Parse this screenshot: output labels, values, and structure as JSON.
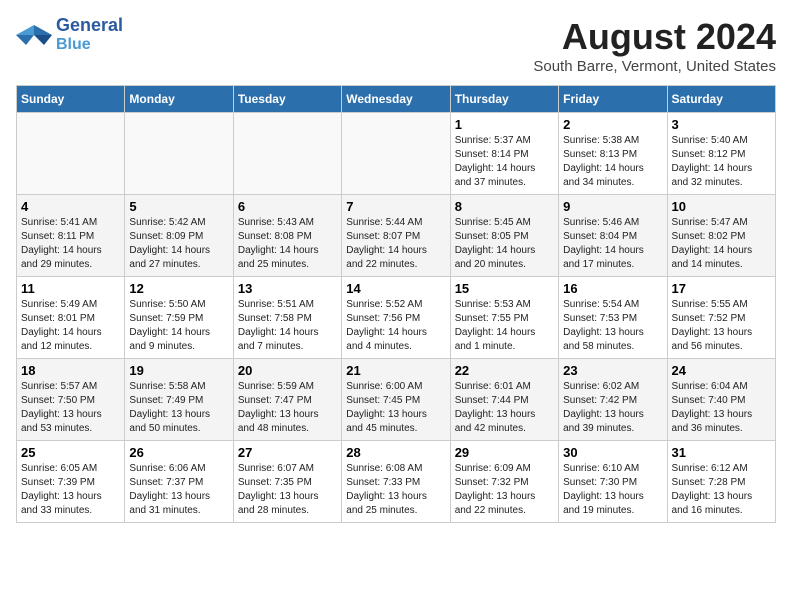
{
  "logo": {
    "line1": "General",
    "line2": "Blue"
  },
  "title": "August 2024",
  "subtitle": "South Barre, Vermont, United States",
  "days_header": [
    "Sunday",
    "Monday",
    "Tuesday",
    "Wednesday",
    "Thursday",
    "Friday",
    "Saturday"
  ],
  "weeks": [
    [
      {
        "num": "",
        "info": ""
      },
      {
        "num": "",
        "info": ""
      },
      {
        "num": "",
        "info": ""
      },
      {
        "num": "",
        "info": ""
      },
      {
        "num": "1",
        "info": "Sunrise: 5:37 AM\nSunset: 8:14 PM\nDaylight: 14 hours\nand 37 minutes."
      },
      {
        "num": "2",
        "info": "Sunrise: 5:38 AM\nSunset: 8:13 PM\nDaylight: 14 hours\nand 34 minutes."
      },
      {
        "num": "3",
        "info": "Sunrise: 5:40 AM\nSunset: 8:12 PM\nDaylight: 14 hours\nand 32 minutes."
      }
    ],
    [
      {
        "num": "4",
        "info": "Sunrise: 5:41 AM\nSunset: 8:11 PM\nDaylight: 14 hours\nand 29 minutes."
      },
      {
        "num": "5",
        "info": "Sunrise: 5:42 AM\nSunset: 8:09 PM\nDaylight: 14 hours\nand 27 minutes."
      },
      {
        "num": "6",
        "info": "Sunrise: 5:43 AM\nSunset: 8:08 PM\nDaylight: 14 hours\nand 25 minutes."
      },
      {
        "num": "7",
        "info": "Sunrise: 5:44 AM\nSunset: 8:07 PM\nDaylight: 14 hours\nand 22 minutes."
      },
      {
        "num": "8",
        "info": "Sunrise: 5:45 AM\nSunset: 8:05 PM\nDaylight: 14 hours\nand 20 minutes."
      },
      {
        "num": "9",
        "info": "Sunrise: 5:46 AM\nSunset: 8:04 PM\nDaylight: 14 hours\nand 17 minutes."
      },
      {
        "num": "10",
        "info": "Sunrise: 5:47 AM\nSunset: 8:02 PM\nDaylight: 14 hours\nand 14 minutes."
      }
    ],
    [
      {
        "num": "11",
        "info": "Sunrise: 5:49 AM\nSunset: 8:01 PM\nDaylight: 14 hours\nand 12 minutes."
      },
      {
        "num": "12",
        "info": "Sunrise: 5:50 AM\nSunset: 7:59 PM\nDaylight: 14 hours\nand 9 minutes."
      },
      {
        "num": "13",
        "info": "Sunrise: 5:51 AM\nSunset: 7:58 PM\nDaylight: 14 hours\nand 7 minutes."
      },
      {
        "num": "14",
        "info": "Sunrise: 5:52 AM\nSunset: 7:56 PM\nDaylight: 14 hours\nand 4 minutes."
      },
      {
        "num": "15",
        "info": "Sunrise: 5:53 AM\nSunset: 7:55 PM\nDaylight: 14 hours\nand 1 minute."
      },
      {
        "num": "16",
        "info": "Sunrise: 5:54 AM\nSunset: 7:53 PM\nDaylight: 13 hours\nand 58 minutes."
      },
      {
        "num": "17",
        "info": "Sunrise: 5:55 AM\nSunset: 7:52 PM\nDaylight: 13 hours\nand 56 minutes."
      }
    ],
    [
      {
        "num": "18",
        "info": "Sunrise: 5:57 AM\nSunset: 7:50 PM\nDaylight: 13 hours\nand 53 minutes."
      },
      {
        "num": "19",
        "info": "Sunrise: 5:58 AM\nSunset: 7:49 PM\nDaylight: 13 hours\nand 50 minutes."
      },
      {
        "num": "20",
        "info": "Sunrise: 5:59 AM\nSunset: 7:47 PM\nDaylight: 13 hours\nand 48 minutes."
      },
      {
        "num": "21",
        "info": "Sunrise: 6:00 AM\nSunset: 7:45 PM\nDaylight: 13 hours\nand 45 minutes."
      },
      {
        "num": "22",
        "info": "Sunrise: 6:01 AM\nSunset: 7:44 PM\nDaylight: 13 hours\nand 42 minutes."
      },
      {
        "num": "23",
        "info": "Sunrise: 6:02 AM\nSunset: 7:42 PM\nDaylight: 13 hours\nand 39 minutes."
      },
      {
        "num": "24",
        "info": "Sunrise: 6:04 AM\nSunset: 7:40 PM\nDaylight: 13 hours\nand 36 minutes."
      }
    ],
    [
      {
        "num": "25",
        "info": "Sunrise: 6:05 AM\nSunset: 7:39 PM\nDaylight: 13 hours\nand 33 minutes."
      },
      {
        "num": "26",
        "info": "Sunrise: 6:06 AM\nSunset: 7:37 PM\nDaylight: 13 hours\nand 31 minutes."
      },
      {
        "num": "27",
        "info": "Sunrise: 6:07 AM\nSunset: 7:35 PM\nDaylight: 13 hours\nand 28 minutes."
      },
      {
        "num": "28",
        "info": "Sunrise: 6:08 AM\nSunset: 7:33 PM\nDaylight: 13 hours\nand 25 minutes."
      },
      {
        "num": "29",
        "info": "Sunrise: 6:09 AM\nSunset: 7:32 PM\nDaylight: 13 hours\nand 22 minutes."
      },
      {
        "num": "30",
        "info": "Sunrise: 6:10 AM\nSunset: 7:30 PM\nDaylight: 13 hours\nand 19 minutes."
      },
      {
        "num": "31",
        "info": "Sunrise: 6:12 AM\nSunset: 7:28 PM\nDaylight: 13 hours\nand 16 minutes."
      }
    ]
  ]
}
